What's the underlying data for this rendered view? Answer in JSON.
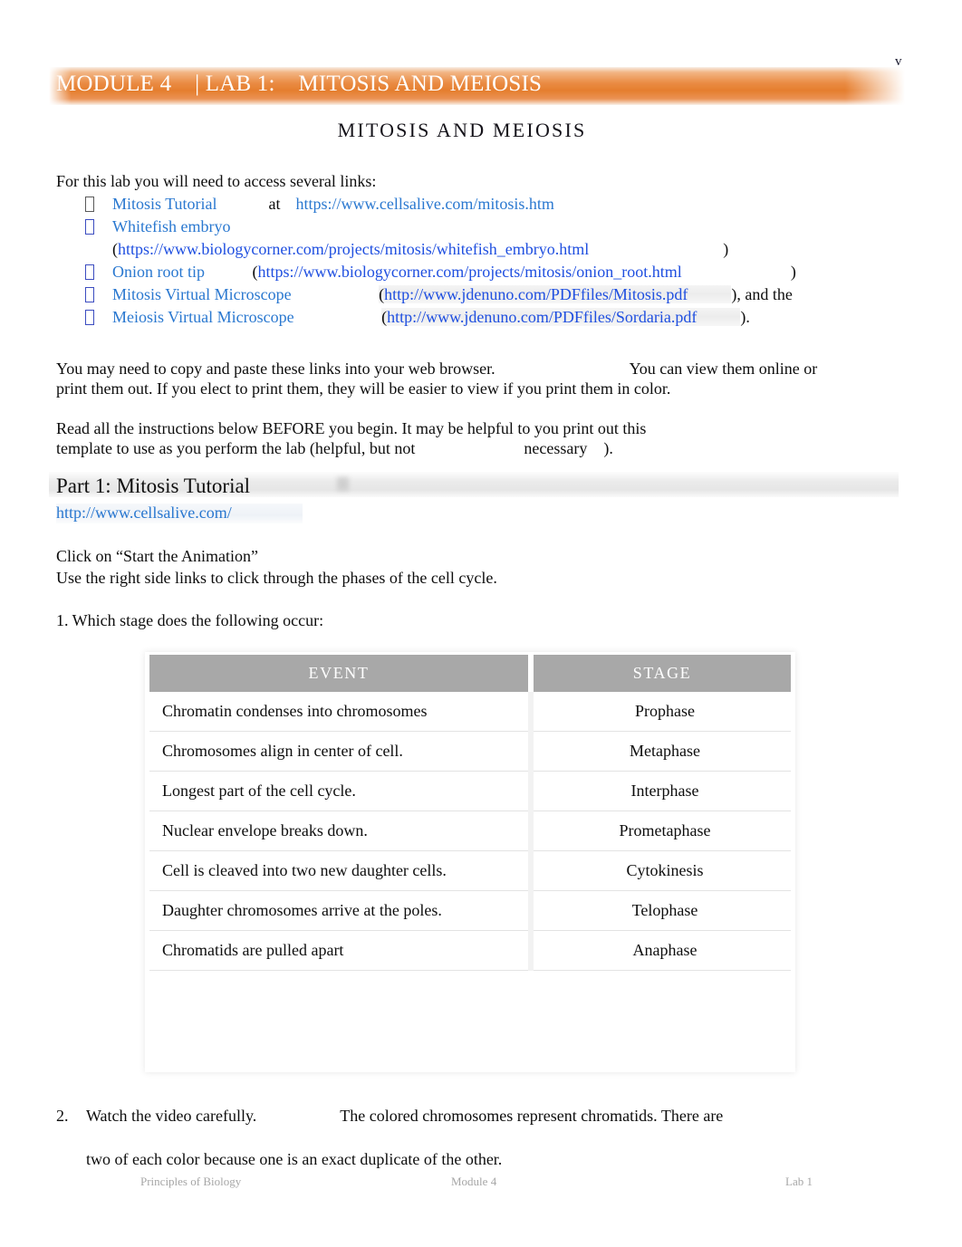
{
  "corner": {
    "stray_char": "v"
  },
  "banner": {
    "text": "MODULE 4    | LAB 1:    MITOSIS AND MEIOSIS",
    "color": "#e57e2e",
    "text_color": "#ffffff"
  },
  "doc_title": "MITOSIS AND MEIOSIS",
  "intro": {
    "lead": "For this lab you will need to access several links:",
    "links": [
      {
        "label": "Mitosis Tutorial",
        "connector": "at",
        "url": "https://www.cellsalive.com/mitosis.htm",
        "open_paren": "",
        "close_paren": "",
        "trailing": ""
      },
      {
        "label": "Whitefish embryo",
        "connector": "",
        "url": "https://www.biologycorner.com/projects/mitosis/whitefish_embryo.html",
        "open_paren": "(",
        "close_paren": ")",
        "trailing": ""
      },
      {
        "label": "Onion root tip",
        "connector": "",
        "url": "https://www.biologycorner.com/projects/mitosis/onion_root.html",
        "open_paren": "(",
        "close_paren": ")",
        "trailing": ""
      },
      {
        "label": "Mitosis Virtual Microscope",
        "connector": "",
        "url": "http://www.jdenuno.com/PDFfiles/Mitosis.pdf",
        "open_paren": "(",
        "close_paren": ")",
        "trailing": ", and the"
      },
      {
        "label": "Meiosis Virtual Microscope",
        "connector": "",
        "url": "http://www.jdenuno.com/PDFfiles/Sordaria.pdf",
        "open_paren": "(",
        "close_paren": ")",
        "trailing": "."
      }
    ]
  },
  "paragraphs": {
    "browser_line1a": "You may need to copy and paste these links into your web browser.",
    "browser_line1b": "You can view them online or",
    "browser_line2": "print them out. If you elect to print them, they will be easier to view if you print them in color.",
    "read_line1": "Read all the instructions below BEFORE you begin. It may be helpful to you print out this",
    "read_line2a": "template to use as you perform the lab (helpful, but not",
    "read_line2b": "necessary",
    "read_line2c": ")."
  },
  "part1": {
    "heading": "Part 1: Mitosis Tutorial",
    "url": "http://www.cellsalive.com/",
    "instruction_line1": "Click on “Start the Animation”",
    "instruction_line2": "Use the right side links to click through the phases of the cell cycle.",
    "question1": "1. Which stage does the following occur:"
  },
  "table": {
    "header_bg": "#a8a8a8",
    "columns": [
      "EVENT",
      "STAGE"
    ],
    "rows": [
      {
        "event": "Chromatin condenses into chromosomes",
        "stage": "Prophase"
      },
      {
        "event": "Chromosomes align in center of cell.",
        "stage": "Metaphase"
      },
      {
        "event": "Longest part of the cell cycle.",
        "stage": "Interphase"
      },
      {
        "event": "Nuclear envelope breaks down.",
        "stage": "Prometaphase"
      },
      {
        "event": "Cell is cleaved into two new daughter cells.",
        "stage": "Cytokinesis"
      },
      {
        "event": "Daughter chromosomes arrive at the poles.",
        "stage": "Telophase"
      },
      {
        "event": "Chromatids are pulled apart",
        "stage": "Anaphase"
      }
    ]
  },
  "question2": {
    "number": "2.",
    "line1a": "Watch the video carefully.",
    "line1b": "The colored chromosomes represent chromatids. There are",
    "line2": "two of each color because one is an exact duplicate of the other."
  },
  "footer": {
    "left": "Principles of Biology",
    "middle": "Module 4",
    "right": "Lab 1"
  }
}
